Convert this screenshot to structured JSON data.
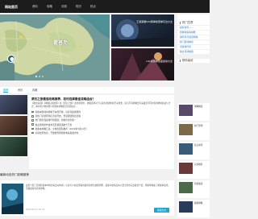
{
  "nav": {
    "brand": "网站首页",
    "items": [
      "资料",
      "攻略",
      "评测",
      "知识",
      "热点"
    ]
  },
  "hero": {
    "map_place_label": "霍普岛"
  },
  "thumbs": [
    {
      "caption": "王者荣耀S39赛季新赛季玩法大全"
    },
    {
      "caption": "LOL新赛季装备改动大全"
    }
  ],
  "sidebar": {
    "hot_title": "热门文章",
    "hot_links": [
      "最新资讯——",
      "原神新版本前瞻",
      "崩坏星穹铁道攻略",
      "热门游戏推荐",
      "手游排行榜",
      "独立游戏精选"
    ],
    "recommend_title": "猜你喜欢"
  },
  "tabs": [
    "推荐",
    "资讯",
    "攻略"
  ],
  "news": {
    "headline": "原石之旅最强攻略推荐，如何选择最佳攻略组合？",
    "excerpt": "【图文来源】【攻略玩家推荐】在《原石之旅》这款游戏中，攻略选择对于玩家的游戏体验至关重要，因为不同攻略会带来截然不同的游戏体验和战斗方式，本文将为你详细介绍各种攻略组合的优缺点...",
    "items": [
      "新版本游戏内测将于本月开放，玩家可提前预约",
      "某热门手游周年庆活动开启，登录即送限定皮肤",
      "热门角色强度排行榜更新，新角色位列第一",
      "独立游戏新作发布首日销量突破十万份",
      "新版本攻略汇总，全角色配队推荐（2024年5月11日）",
      "玩家社区热议：开放世界游戏的未来发展方向"
    ]
  },
  "section": {
    "title": "最新动态热门攻略推荐"
  },
  "article": {
    "text": "这里介绍了游戏新版本中的各项改动内容，玩家可以在这里看到最新的角色技能调整、装备平衡性改动以及全新的玩法模式介绍，帮助你快速了解版本变化，掌握最新的游戏攻略。",
    "meta": "2024-05-11 15:33",
    "more": "阅读全文"
  },
  "right_list": [
    {
      "text": "攻略精选"
    },
    {
      "text": "热门评测"
    },
    {
      "text": "每日资讯"
    },
    {
      "text": "玩家推荐"
    },
    {
      "text": "新游速递"
    },
    {
      "text": "视频攻略"
    }
  ],
  "colors": {
    "accent": "#20a6d0",
    "nav_bg": "#1c1c1c"
  }
}
